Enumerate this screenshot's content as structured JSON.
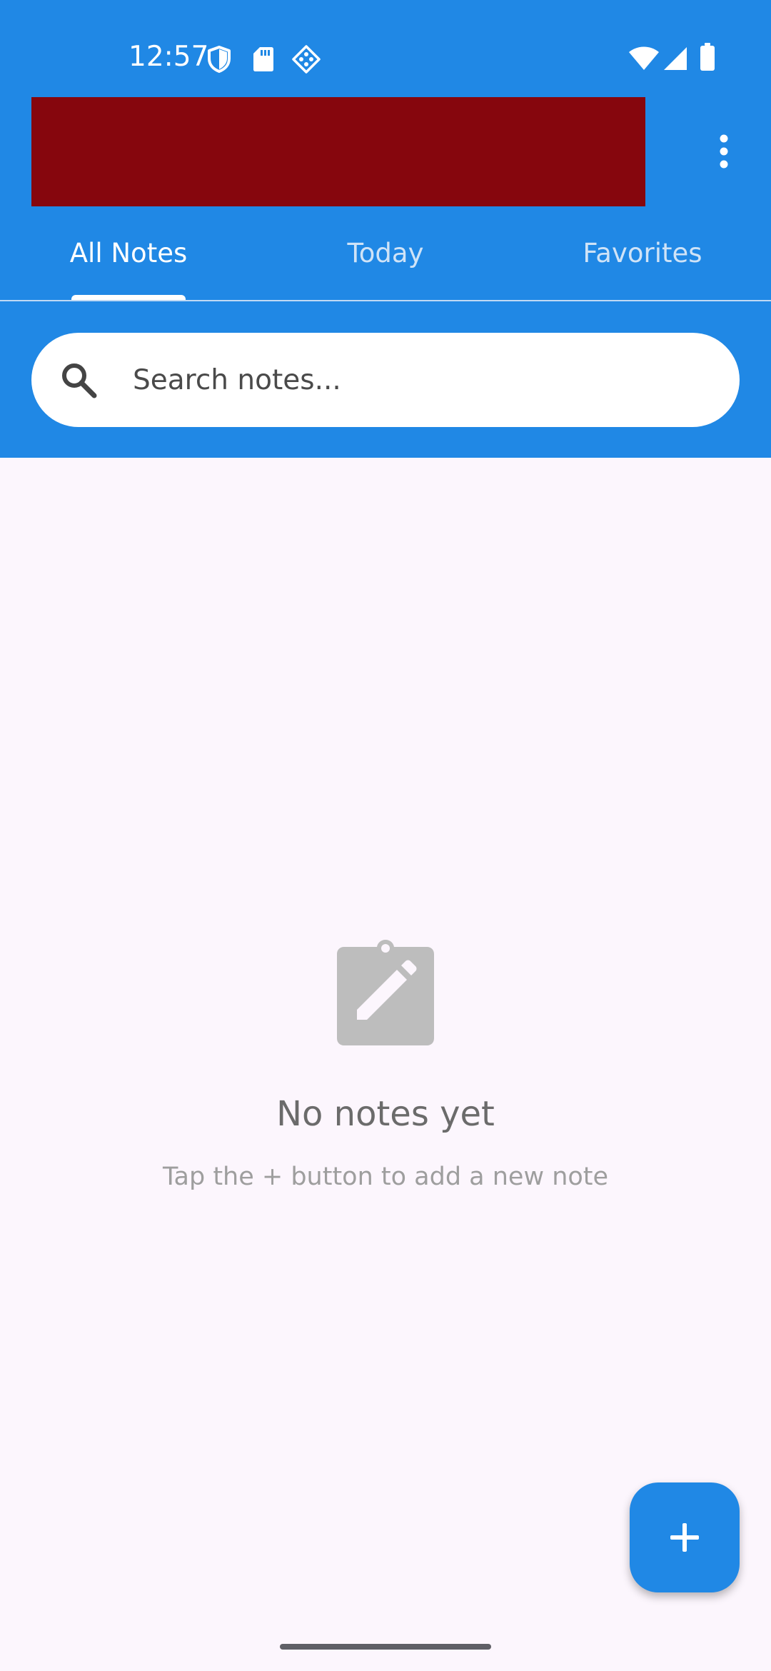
{
  "status_bar": {
    "time": "12:57",
    "left_icons": [
      "shield-icon",
      "sd-card-icon",
      "game-diamond-icon"
    ],
    "right_icons": [
      "wifi-icon",
      "cell-signal-icon",
      "battery-icon"
    ]
  },
  "app_bar": {
    "background_color": "#2088E5",
    "title_redacted": true,
    "redaction_color": "#86060D",
    "menu_icon": "more-vert-icon"
  },
  "tabs": [
    {
      "label": "All Notes",
      "selected": true
    },
    {
      "label": "Today",
      "selected": false
    },
    {
      "label": "Favorites",
      "selected": false
    }
  ],
  "search": {
    "placeholder": "Search notes...",
    "value": "",
    "icon": "search-icon"
  },
  "empty_state": {
    "icon": "clipboard-edit-icon",
    "title": "No notes yet",
    "subtitle": "Tap the + button to add a new note"
  },
  "fab": {
    "icon": "plus-icon",
    "color": "#2088E5"
  },
  "colors": {
    "primary": "#2088E5",
    "background": "#FCF6FD",
    "empty_icon": "#BDBDBD"
  }
}
